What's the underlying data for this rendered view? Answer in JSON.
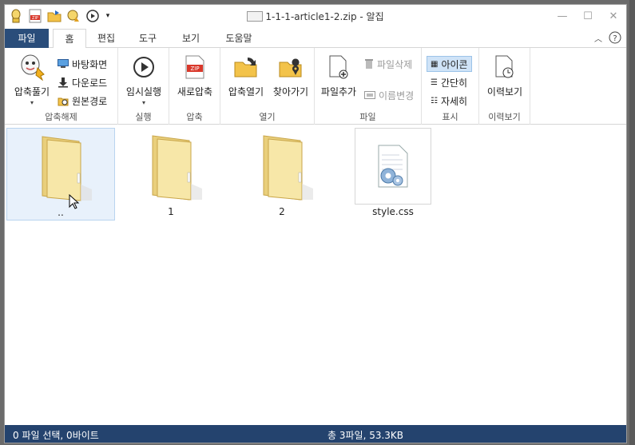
{
  "window": {
    "title": "1-1-1-article1-2.zip - 알집"
  },
  "tabs": {
    "file": "파일",
    "home": "홈",
    "edit": "편집",
    "tools": "도구",
    "view": "보기",
    "help": "도움말"
  },
  "ribbon": {
    "extract": {
      "big": "압축풀기",
      "desktop": "바탕화면",
      "download": "다운로드",
      "original": "원본경로",
      "label": "압축해제"
    },
    "run": {
      "big": "임시실행",
      "label": "실행"
    },
    "compress": {
      "big": "새로압축",
      "label": "압축"
    },
    "open": {
      "open_archive": "압축열기",
      "browse": "찾아가기",
      "label": "열기"
    },
    "file": {
      "add": "파일추가",
      "delete": "파일삭제",
      "rename": "이름변경",
      "label": "파일"
    },
    "display": {
      "icons": "아이콘",
      "simple": "간단히",
      "details": "자세히",
      "label": "표시"
    },
    "history": {
      "big": "이력보기",
      "label": "이력보기"
    }
  },
  "files": [
    {
      "name": "..",
      "type": "folder"
    },
    {
      "name": "1",
      "type": "folder"
    },
    {
      "name": "2",
      "type": "folder"
    },
    {
      "name": "style.css",
      "type": "css"
    }
  ],
  "status": {
    "left": "0 파일 선택, 0바이트",
    "right": "총 3파일, 53.3KB"
  },
  "colors": {
    "file_tab": "#2a4d7a",
    "statusbar": "#24436e",
    "selection": "#e8f1fb"
  }
}
